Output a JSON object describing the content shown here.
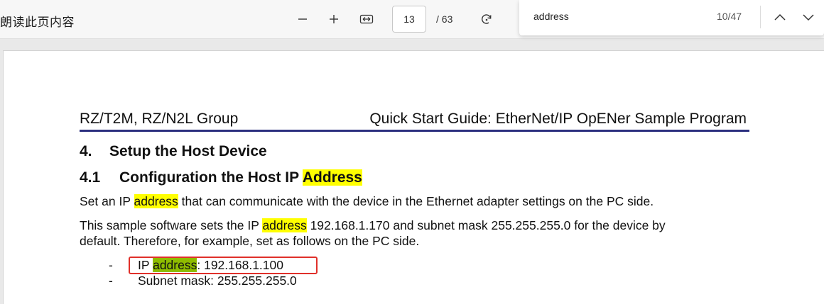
{
  "toolbar": {
    "read_aloud_label": "朗读此页内容",
    "current_page": "13",
    "total_pages": "/ 63"
  },
  "find": {
    "query": "address",
    "match_count": "10/47"
  },
  "document": {
    "header_left": "RZ/T2M, RZ/N2L Group",
    "header_right": "Quick Start Guide: EtherNet/IP OpENer Sample Program",
    "section_number": "4.",
    "section_title": "Setup the Host Device",
    "subsection_number": "4.1",
    "subsection_title_prefix": "Configuration the Host IP ",
    "subsection_title_hl": "Address",
    "para1_a": "Set an IP ",
    "para1_hl": "address",
    "para1_b": " that can communicate with the device in the Ethernet adapter settings on the PC side.",
    "para2_a": "This sample software sets the IP ",
    "para2_hl": "address",
    "para2_b": " 192.168.1.170 and subnet mask 255.255.255.0 for the device by",
    "para2_line2": "default. Therefore, for example, set as follows on the PC side.",
    "bullets": [
      {
        "dash": "-",
        "prefix": "IP ",
        "hl": "address",
        "suffix": ": 192.168.1.100"
      },
      {
        "dash": "-",
        "text": "Subnet mask: 255.255.255.0"
      }
    ]
  },
  "colors": {
    "highlight": "#ffff00",
    "current_highlight": "#8fbc00",
    "header_rule": "#2b2f7f",
    "annotation_box": "#e0302a"
  }
}
